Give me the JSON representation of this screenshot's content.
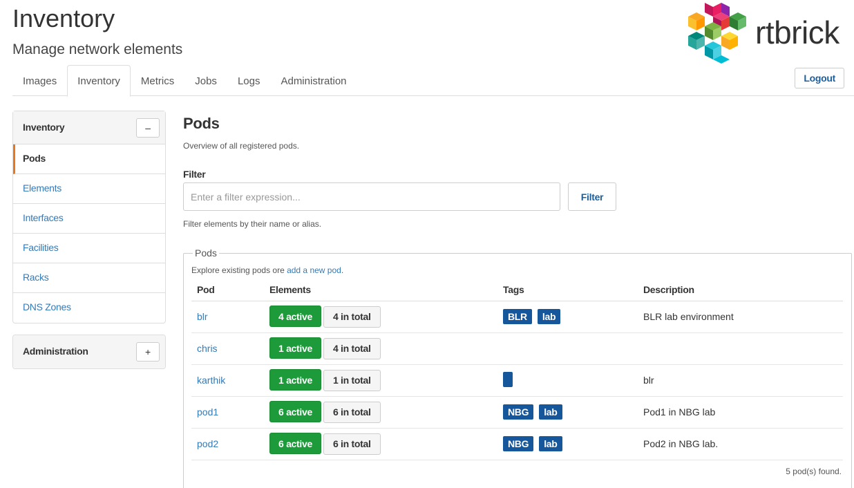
{
  "header": {
    "title": "Inventory",
    "subtitle": "Manage network elements",
    "logo_text": "rtbrick",
    "logout_label": "Logout"
  },
  "tabs": [
    {
      "label": "Images",
      "active": false
    },
    {
      "label": "Inventory",
      "active": true
    },
    {
      "label": "Metrics",
      "active": false
    },
    {
      "label": "Jobs",
      "active": false
    },
    {
      "label": "Logs",
      "active": false
    },
    {
      "label": "Administration",
      "active": false
    }
  ],
  "sidebar": {
    "inventory_panel": {
      "title": "Inventory",
      "toggle": "–",
      "items": [
        {
          "label": "Pods",
          "active": true
        },
        {
          "label": "Elements",
          "active": false
        },
        {
          "label": "Interfaces",
          "active": false
        },
        {
          "label": "Facilities",
          "active": false
        },
        {
          "label": "Racks",
          "active": false
        },
        {
          "label": "DNS Zones",
          "active": false
        }
      ]
    },
    "admin_panel": {
      "title": "Administration",
      "toggle": "+"
    }
  },
  "main": {
    "heading": "Pods",
    "description": "Overview of all registered pods.",
    "filter": {
      "label": "Filter",
      "placeholder": "Enter a filter expression...",
      "button": "Filter",
      "help": "Filter elements by their name or alias."
    },
    "pods_section": {
      "legend": "Pods",
      "explore_prefix": "Explore existing pods ore ",
      "explore_link": "add a new pod",
      "explore_suffix": ".",
      "columns": [
        "Pod",
        "Elements",
        "Tags",
        "Description"
      ],
      "rows": [
        {
          "pod": "blr",
          "active": "4 active",
          "total": "4 in total",
          "tags": [
            "BLR",
            "lab"
          ],
          "description": "BLR lab environment"
        },
        {
          "pod": "chris",
          "active": "1 active",
          "total": "4 in total",
          "tags": [],
          "description": ""
        },
        {
          "pod": "karthik",
          "active": "1 active",
          "total": "1 in total",
          "tags": [
            ""
          ],
          "description": "blr"
        },
        {
          "pod": "pod1",
          "active": "6 active",
          "total": "6 in total",
          "tags": [
            "NBG",
            "lab"
          ],
          "description": "Pod1 in NBG lab"
        },
        {
          "pod": "pod2",
          "active": "6 active",
          "total": "6 in total",
          "tags": [
            "NBG",
            "lab"
          ],
          "description": "Pod2 in NBG lab."
        }
      ],
      "found": "5 pod(s) found."
    }
  },
  "colors": {
    "accent": "#337ab7",
    "active_green": "#1d9a3a",
    "tag_blue": "#16569a",
    "active_nav_border": "#e8771e"
  }
}
